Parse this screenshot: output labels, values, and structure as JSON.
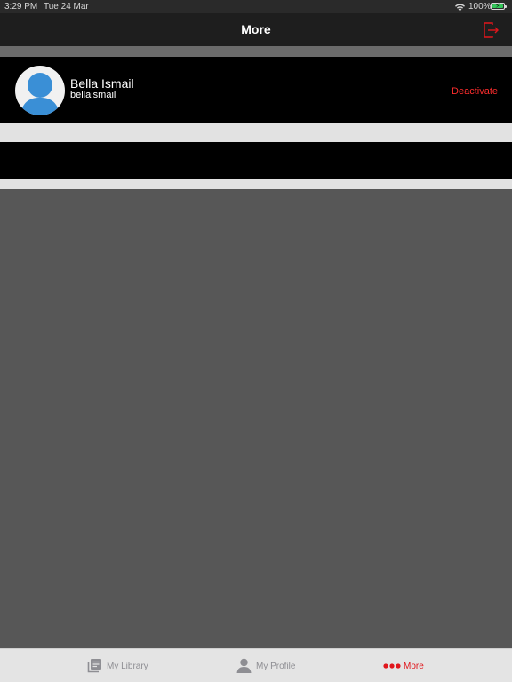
{
  "status_bar": {
    "time": "3:29 PM",
    "date": "Tue 24 Mar",
    "battery": "100%",
    "icons": [
      "wifi-icon",
      "battery-icon"
    ]
  },
  "nav": {
    "title": "More",
    "logout_icon": "logout-icon"
  },
  "profile": {
    "name": "Bella Ismail",
    "username": "bellaismail",
    "action": "Deactivate",
    "avatar_icon": "user-avatar-icon"
  },
  "tabs": [
    {
      "label": "My Library",
      "icon": "library-icon",
      "selected": false
    },
    {
      "label": "My Profile",
      "icon": "profile-icon",
      "selected": false
    },
    {
      "label": "More",
      "icon": "more-dots-icon",
      "selected": true
    }
  ],
  "colors": {
    "accent": "#e0161c",
    "inactive_tab": "#8e8e93",
    "avatar_blue": "#3a8fd6",
    "background": "#575757"
  }
}
